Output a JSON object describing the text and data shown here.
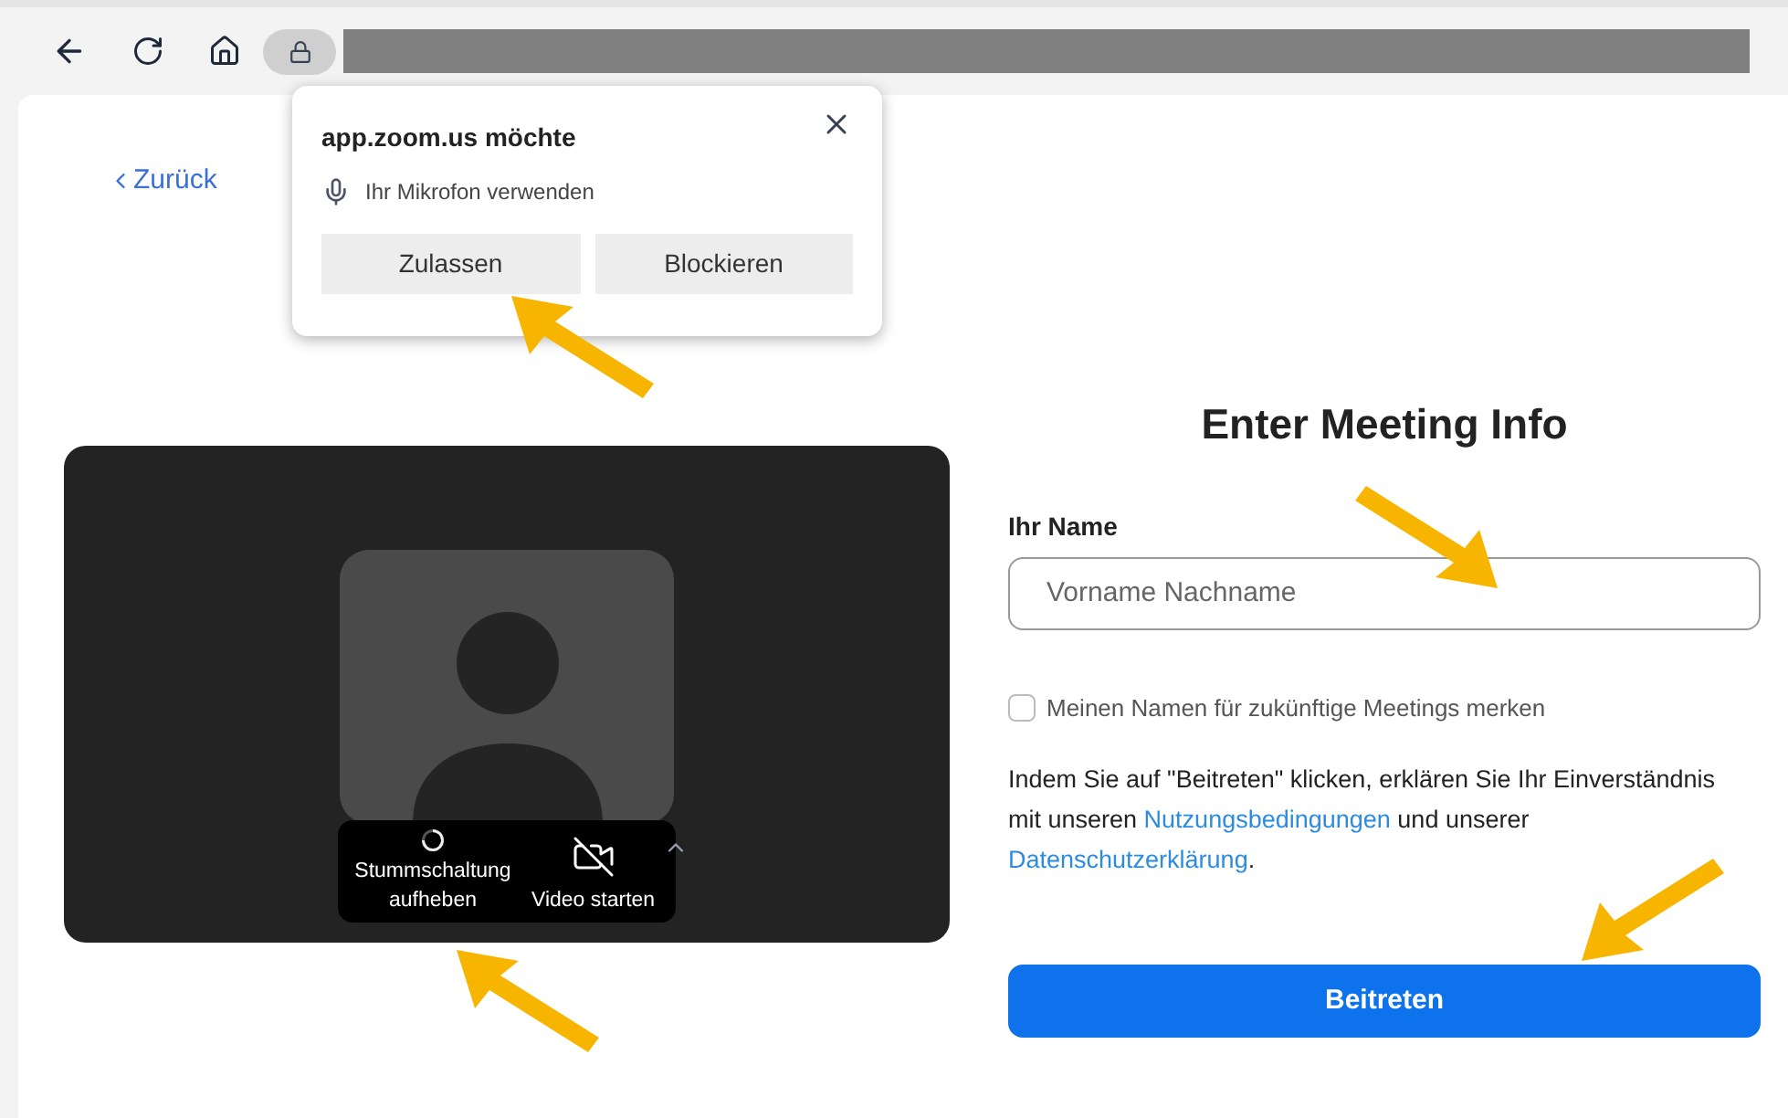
{
  "back_link": "Zurück",
  "permission_popup": {
    "title": "app.zoom.us möchte",
    "request": "Ihr Mikrofon verwenden",
    "buttons": [
      "Zulassen",
      "Blockieren"
    ]
  },
  "preview": {
    "controls": [
      {
        "kind": "audio",
        "label": "Stummschaltung aufheben"
      },
      {
        "kind": "video",
        "label": "Video starten"
      }
    ]
  },
  "form": {
    "heading": "Enter Meeting Info",
    "name_label": "Ihr Name",
    "name_field": {
      "placeholder": "Vorname Nachname"
    },
    "remember": {
      "label": "Meinen Namen für zukünftige Meetings merken",
      "checked": false
    },
    "consent": {
      "text_before": "Indem Sie auf \"Beitreten\" klicken, erklären Sie Ihr Einverständnis mit unseren ",
      "terms_link": "Nutzungsbedingungen",
      "text_middle": " und unserer ",
      "privacy_link": "Datenschutzerklärung",
      "text_after": "."
    },
    "join_button": "Beitreten"
  }
}
